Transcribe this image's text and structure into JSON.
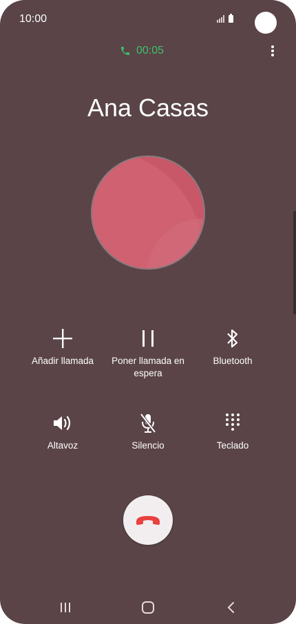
{
  "status": {
    "time": "10:00"
  },
  "call": {
    "duration": "00:05",
    "caller_name": "Ana Casas"
  },
  "actions": [
    {
      "label": "Añadir llamada",
      "icon": "plus-icon"
    },
    {
      "label": "Poner llamada en espera",
      "icon": "pause-icon"
    },
    {
      "label": "Bluetooth",
      "icon": "bluetooth-icon"
    },
    {
      "label": "Altavoz",
      "icon": "speaker-icon"
    },
    {
      "label": "Silencio",
      "icon": "mic-off-icon"
    },
    {
      "label": "Teclado",
      "icon": "keypad-icon"
    }
  ],
  "colors": {
    "background": "#5a4448",
    "timer_green": "#3fbf6a",
    "avatar": "#c85868",
    "end_call_red": "#e8413f"
  },
  "navigation": [
    "recents-icon",
    "home-icon",
    "back-icon"
  ]
}
